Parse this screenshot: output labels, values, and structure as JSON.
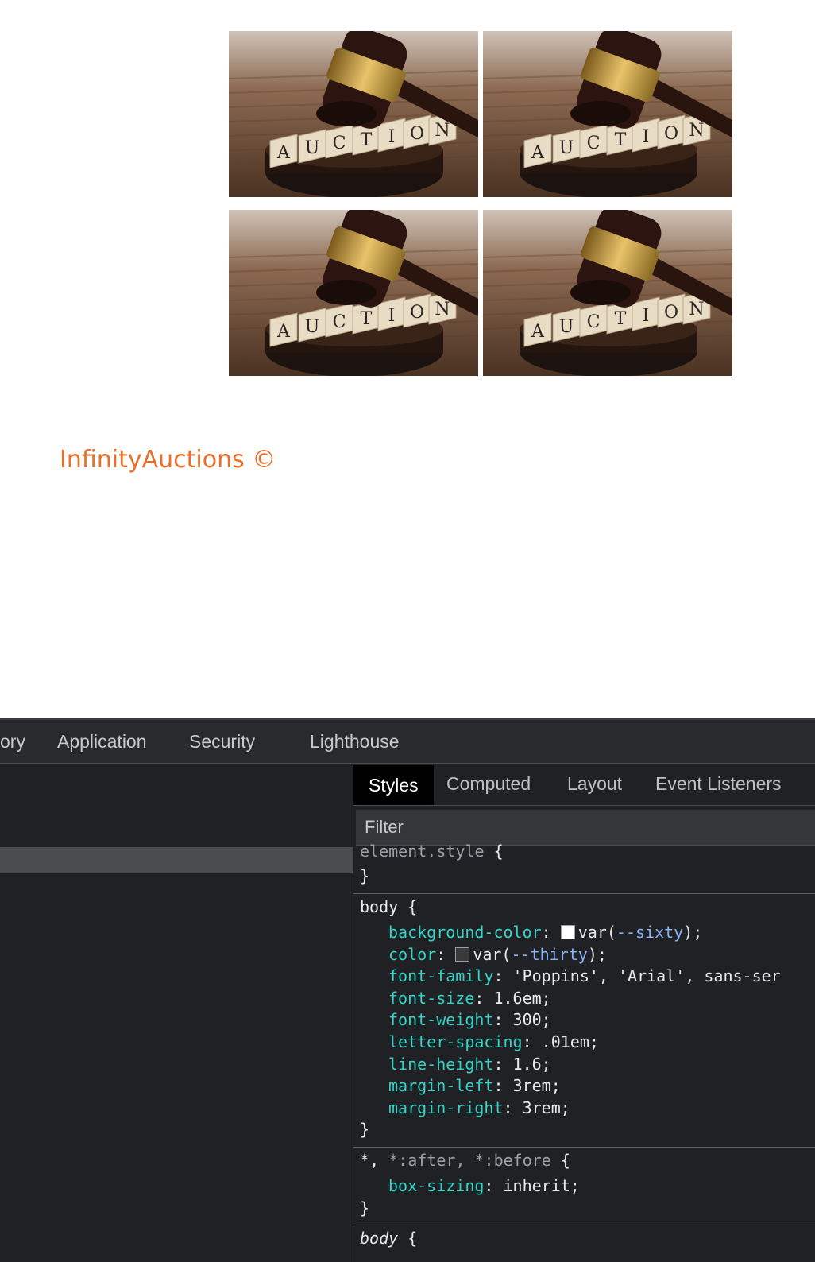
{
  "brand": {
    "text": "InfinityAuctions ©"
  },
  "gallery": {
    "image_word": "AUCTION",
    "letters": [
      "A",
      "U",
      "C",
      "T",
      "I",
      "O",
      "N"
    ]
  },
  "devtools": {
    "top_tabs": [
      "ory",
      "Application",
      "Security",
      "Lighthouse"
    ],
    "sub_tabs": [
      "Styles",
      "Computed",
      "Layout",
      "Event Listeners"
    ],
    "filter_placeholder": "Filter",
    "rules": {
      "element_style": {
        "selector": "element.style",
        "open": "{",
        "close": "}"
      },
      "body": {
        "selector": "body",
        "open": "{",
        "close": "}",
        "declarations": [
          {
            "prop": "background-color",
            "colon": ":",
            "value_pre": "var(",
            "var": "--sixty",
            "value_post": ");",
            "swatch": "#ffffff"
          },
          {
            "prop": "color",
            "colon": ":",
            "value_pre": "var(",
            "var": "--thirty",
            "value_post": ");",
            "swatch": "#3a3a3a"
          },
          {
            "prop": "font-family",
            "colon": ":",
            "value": "'Poppins', 'Arial', sans-ser"
          },
          {
            "prop": "font-size",
            "colon": ":",
            "value": "1.6em;"
          },
          {
            "prop": "font-weight",
            "colon": ":",
            "value": "300;"
          },
          {
            "prop": "letter-spacing",
            "colon": ":",
            "value": ".01em;"
          },
          {
            "prop": "line-height",
            "colon": ":",
            "value": "1.6;"
          },
          {
            "prop": "margin-left",
            "colon": ":",
            "value": "3rem;"
          },
          {
            "prop": "margin-right",
            "colon": ":",
            "value": "3rem;"
          }
        ]
      },
      "universal": {
        "selector_star": "*,",
        "selector_rest": "*:after, *:before",
        "open": "{",
        "close": "}",
        "declarations": [
          {
            "prop": "box-sizing",
            "colon": ":",
            "value": "inherit;"
          }
        ]
      },
      "body2": {
        "selector": "body",
        "open": "{"
      }
    }
  }
}
